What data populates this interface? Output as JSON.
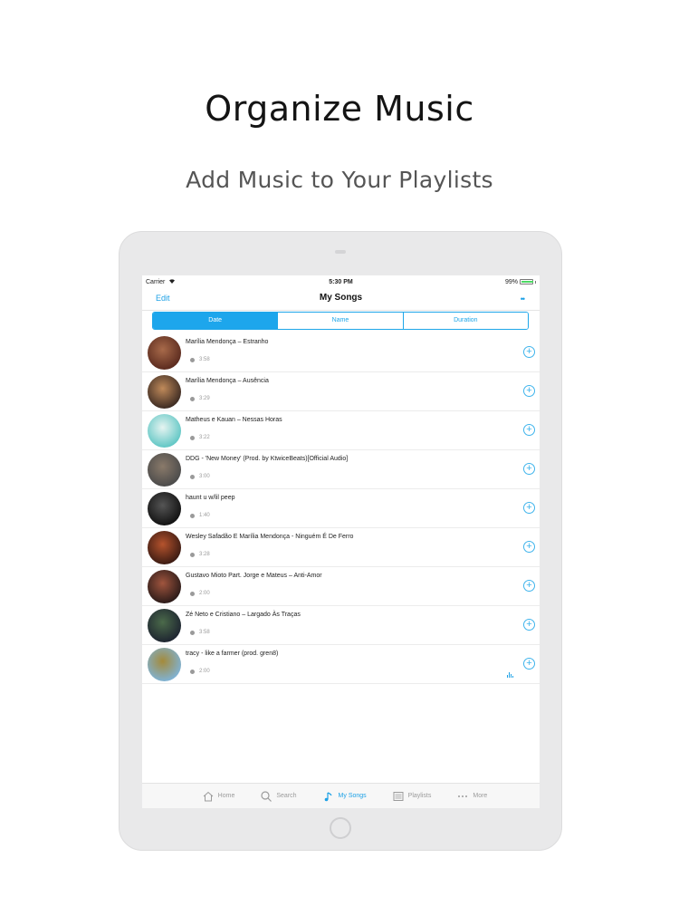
{
  "promo": {
    "headline": "Organize Music",
    "subheadline": "Add Music to Your Playlists"
  },
  "status_bar": {
    "carrier": "Carrier",
    "time": "5:30 PM",
    "battery": "99%",
    "battery_level": 0.99
  },
  "nav": {
    "edit": "Edit",
    "title": "My Songs",
    "more": "••"
  },
  "sort_tabs": [
    {
      "label": "Date",
      "active": true
    },
    {
      "label": "Name",
      "active": false
    },
    {
      "label": "Duration",
      "active": false
    }
  ],
  "songs": [
    {
      "title": "Marília Mendonça – Estranho",
      "duration": "3:58",
      "art_colors": [
        "#5a2a1e",
        "#a86a4a"
      ]
    },
    {
      "title": "Marília Mendonça – Ausência",
      "duration": "3:29",
      "art_colors": [
        "#3b2a22",
        "#c08a5a"
      ]
    },
    {
      "title": "Matheus e Kauan – Nessas Horas",
      "duration": "3:22",
      "art_colors": [
        "#5fc6c4",
        "#e6f4f1"
      ]
    },
    {
      "title": "DDG - 'New Money' (Prod. by KtwiceBeats)[Official Audio]",
      "duration": "3:00",
      "art_colors": [
        "#4a4a4a",
        "#8a7a6a"
      ]
    },
    {
      "title": "haunt u w/lil peep",
      "duration": "1:40",
      "art_colors": [
        "#111111",
        "#555555"
      ]
    },
    {
      "title": "Wesley Safadão E Marília Mendonça - Ninguém É De Ferro",
      "duration": "3:28",
      "art_colors": [
        "#3a1a12",
        "#b5532d"
      ]
    },
    {
      "title": "Gustavo Mioto Part. Jorge e Mateus – Anti-Amor",
      "duration": "2:00",
      "art_colors": [
        "#2a1a18",
        "#a0553e"
      ]
    },
    {
      "title": "Zé Neto e Cristiano  – Largado Às Traças",
      "duration": "3:58",
      "art_colors": [
        "#1d2430",
        "#4b6a4a"
      ]
    },
    {
      "title": "tracy - like a farmer (prod. gren8)",
      "duration": "2:00",
      "art_colors": [
        "#7fb3d6",
        "#a48a3a"
      ],
      "now_playing": true
    }
  ],
  "tab_bar": [
    {
      "label": "Home",
      "icon": "home-icon",
      "active": false
    },
    {
      "label": "Search",
      "icon": "search-icon",
      "active": false
    },
    {
      "label": "My Songs",
      "icon": "music-note-icon",
      "active": true
    },
    {
      "label": "Playlists",
      "icon": "playlists-icon",
      "active": false
    },
    {
      "label": "More",
      "icon": "more-icon",
      "active": false
    }
  ],
  "colors": {
    "accent": "#1da1e6",
    "tab_inactive": "#9b9b9b"
  }
}
